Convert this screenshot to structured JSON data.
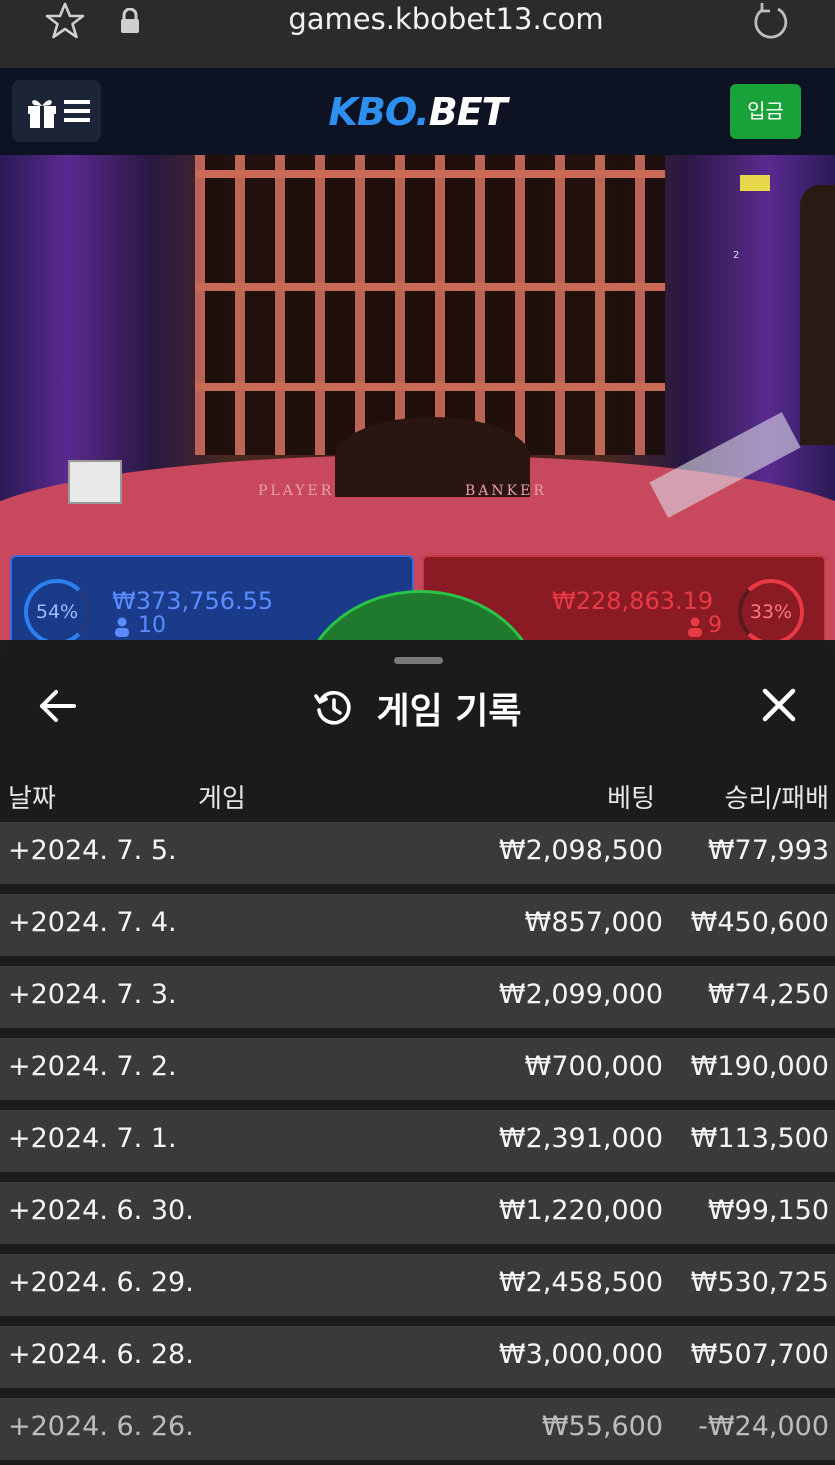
{
  "browser": {
    "url": "games.kbobet13.com",
    "icons": [
      "star-icon",
      "lock-icon",
      "reload-icon"
    ]
  },
  "header": {
    "logo_part1": "KBO.",
    "logo_part2": "BET",
    "deposit_label": "입금",
    "menu_icons": [
      "gift-icon",
      "hamburger-icon"
    ]
  },
  "game": {
    "player_label": "PLAYER",
    "banker_label": "BANKER",
    "player_pct": "54%",
    "player_amount": "₩373,756.55",
    "player_count": "10",
    "banker_pct": "33%",
    "banker_amount": "₩228,863.19",
    "banker_count": "9",
    "seat_number": "2"
  },
  "history": {
    "title": "게임 기록",
    "columns": {
      "date": "날짜",
      "game": "게임",
      "bet": "베팅",
      "winloss": "승리/패배"
    },
    "rows": [
      {
        "date": "+2024. 7. 5.",
        "bet": "₩2,098,500",
        "winloss": "₩77,993"
      },
      {
        "date": "+2024. 7. 4.",
        "bet": "₩857,000",
        "winloss": "₩450,600"
      },
      {
        "date": "+2024. 7. 3.",
        "bet": "₩2,099,000",
        "winloss": "₩74,250"
      },
      {
        "date": "+2024. 7. 2.",
        "bet": "₩700,000",
        "winloss": "₩190,000"
      },
      {
        "date": "+2024. 7. 1.",
        "bet": "₩2,391,000",
        "winloss": "₩113,500"
      },
      {
        "date": "+2024. 6. 30.",
        "bet": "₩1,220,000",
        "winloss": "₩99,150"
      },
      {
        "date": "+2024. 6. 29.",
        "bet": "₩2,458,500",
        "winloss": "₩530,725"
      },
      {
        "date": "+2024. 6. 28.",
        "bet": "₩3,000,000",
        "winloss": "₩507,700"
      },
      {
        "date": "+2024. 6. 26.",
        "bet": "₩55,600",
        "winloss": "-₩24,000"
      }
    ]
  },
  "colors": {
    "accent_blue": "#2d8ff0",
    "deposit_green": "#19a23a",
    "row_bg": "#3a3a3a",
    "sheet_bg": "#1c1c1c"
  }
}
